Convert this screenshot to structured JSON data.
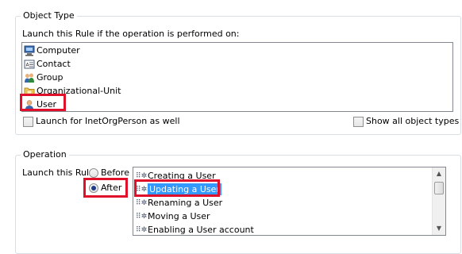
{
  "object_type": {
    "group_title": "Object Type",
    "prompt": "Launch this Rule if the operation is performed on:",
    "items": [
      {
        "label": "Computer",
        "icon": "computer-icon"
      },
      {
        "label": "Contact",
        "icon": "contact-card-icon"
      },
      {
        "label": "Group",
        "icon": "group-icon"
      },
      {
        "label": "Organizational-Unit",
        "icon": "folder-icon"
      },
      {
        "label": "User",
        "icon": "user-icon",
        "selected": true
      }
    ],
    "launch_inetorgperson_label": "Launch for InetOrgPerson as well",
    "launch_inetorgperson_checked": false,
    "show_all_label": "Show all object types",
    "show_all_checked": false
  },
  "operation": {
    "group_title": "Operation",
    "launch_label": "Launch this Rule",
    "before_label": "Before",
    "after_label": "After",
    "selected_timing": "After",
    "items": [
      {
        "label": "Creating a User"
      },
      {
        "label": "Updating a User",
        "selected": true
      },
      {
        "label": "Renaming a User"
      },
      {
        "label": "Moving a User"
      },
      {
        "label": "Enabling a User account"
      }
    ]
  },
  "colors": {
    "highlight": "#e0102a",
    "selection": "#3399ff"
  }
}
